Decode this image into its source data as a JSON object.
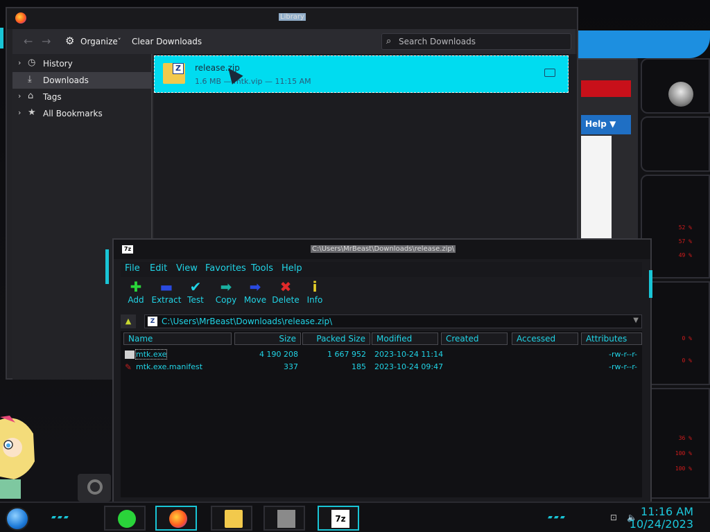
{
  "library": {
    "title": "Library",
    "toolbar": {
      "organize": "Organize",
      "organize_arrow": "˅",
      "clear": "Clear Downloads",
      "search_placeholder": "Search Downloads"
    },
    "sidebar": [
      {
        "label": "History",
        "icon": "clock-icon",
        "expandable": true
      },
      {
        "label": "Downloads",
        "icon": "download-icon",
        "expandable": false,
        "selected": true
      },
      {
        "label": "Tags",
        "icon": "tag-icon",
        "expandable": true
      },
      {
        "label": "All Bookmarks",
        "icon": "star-icon",
        "expandable": true
      }
    ],
    "download": {
      "name": "release.zip",
      "meta": "1.6 MB — mtk.vip — 11:15 AM"
    }
  },
  "sevenzip": {
    "title": "C:\\Users\\MrBeast\\Downloads\\release.zip\\",
    "logo": "7z",
    "menu": [
      "File",
      "Edit",
      "View",
      "Favorites",
      "Tools",
      "Help"
    ],
    "tools": [
      {
        "label": "Add",
        "glyph": "✚",
        "color": "#2ad43a"
      },
      {
        "label": "Extract",
        "glyph": "▬",
        "color": "#2a4ae0"
      },
      {
        "label": "Test",
        "glyph": "✔",
        "color": "#21d4e6"
      },
      {
        "label": "Copy",
        "glyph": "➡",
        "color": "#1ab0a0"
      },
      {
        "label": "Move",
        "glyph": "➡",
        "color": "#2a4ae0"
      },
      {
        "label": "Delete",
        "glyph": "✖",
        "color": "#e02a2a"
      },
      {
        "label": "Info",
        "glyph": "i",
        "color": "#e8d22a"
      }
    ],
    "path": "C:\\Users\\MrBeast\\Downloads\\release.zip\\",
    "columns": [
      "Name",
      "Size",
      "Packed Size",
      "Modified",
      "Created",
      "Accessed",
      "Attributes"
    ],
    "files": [
      {
        "name": "mtk.exe",
        "size": "4 190 208",
        "packed": "1 667 952",
        "modified": "2023-10-24 11:14",
        "attr": "-rw-r--r-"
      },
      {
        "name": "mtk.exe.manifest",
        "size": "337",
        "packed": "185",
        "modified": "2023-10-24 09:47",
        "attr": "-rw-r--r-"
      }
    ]
  },
  "behind_window": {
    "help": "Help ▼"
  },
  "gadget": {
    "stats": [
      "52 %",
      "57 %",
      "49 %",
      "0 %",
      "0 %",
      "36 %",
      "100 %",
      "100 %"
    ]
  },
  "taskbar": {
    "time": "11:16 AM",
    "date": "10/24/2023",
    "apps": [
      "notes-app",
      "firefox",
      "file-explorer",
      "castle-app",
      "7zip"
    ]
  }
}
